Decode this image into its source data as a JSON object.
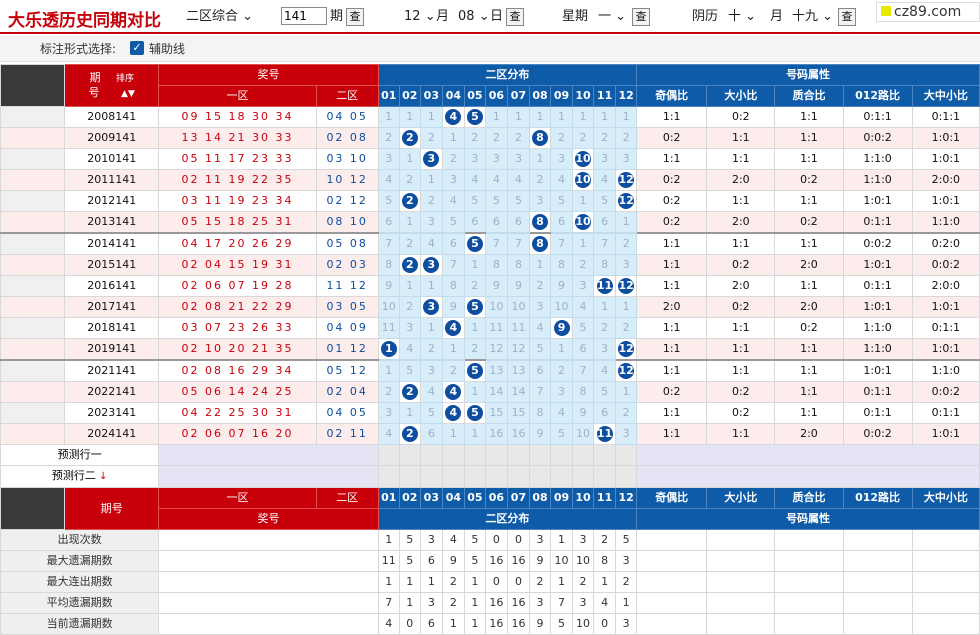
{
  "app": {
    "title": "大乐透历史同期对比",
    "logo": "cz89.com"
  },
  "toolbar": {
    "zone_select": "二区综合",
    "issue_value": "141",
    "issue_label": "期",
    "query_label": "查",
    "solar_month": "12",
    "month_label": "月",
    "solar_day": "08",
    "day_label": "日",
    "weekday_label": "星期",
    "weekday_value": "一",
    "lunar_label": "阴历",
    "lunar_month": "十",
    "lunar_day": "十九"
  },
  "filter": {
    "label": "标注形式选择:",
    "checkbox": "辅助线",
    "checked": true
  },
  "headers": {
    "issue": "期",
    "issue2": "号",
    "sort": "排序",
    "prize": "奖号",
    "zone1": "一区",
    "zone2": "二区",
    "dist": "二区分布",
    "attr": "号码属性",
    "nums": [
      "01",
      "02",
      "03",
      "04",
      "05",
      "06",
      "07",
      "08",
      "09",
      "10",
      "11",
      "12"
    ],
    "attrs": [
      "奇偶比",
      "大小比",
      "质合比",
      "012路比",
      "大中小比"
    ]
  },
  "rows": [
    {
      "issue": "2008141",
      "front": "09 15 18 30 34",
      "back": "04 05",
      "dist": [
        "1",
        "1",
        "1",
        "4",
        "5",
        "1",
        "1",
        "1",
        "1",
        "1",
        "1",
        "1"
      ],
      "balls": [
        4,
        5
      ],
      "attr": [
        "1:1",
        "0:2",
        "1:1",
        "0:1:1",
        "0:1:1"
      ]
    },
    {
      "issue": "2009141",
      "front": "13 14 21 30 33",
      "back": "02 08",
      "dist": [
        "2",
        "2",
        "2",
        "1",
        "2",
        "2",
        "2",
        "8",
        "2",
        "2",
        "2",
        "2"
      ],
      "balls": [
        2,
        8
      ],
      "attr": [
        "0:2",
        "1:1",
        "1:1",
        "0:0:2",
        "1:0:1"
      ]
    },
    {
      "issue": "2010141",
      "front": "05 11 17 23 33",
      "back": "03 10",
      "dist": [
        "3",
        "1",
        "3",
        "2",
        "3",
        "3",
        "3",
        "1",
        "3",
        "10",
        "3",
        "3"
      ],
      "balls": [
        3,
        10
      ],
      "attr": [
        "1:1",
        "1:1",
        "1:1",
        "1:1:0",
        "1:0:1"
      ]
    },
    {
      "issue": "2011141",
      "front": "02 11 19 22 35",
      "back": "10 12",
      "dist": [
        "4",
        "2",
        "1",
        "3",
        "4",
        "4",
        "4",
        "2",
        "4",
        "10",
        "4",
        "12"
      ],
      "balls": [
        10,
        12
      ],
      "attr": [
        "0:2",
        "2:0",
        "0:2",
        "1:1:0",
        "2:0:0"
      ]
    },
    {
      "issue": "2012141",
      "front": "03 11 19 23 34",
      "back": "02 12",
      "dist": [
        "5",
        "2",
        "2",
        "4",
        "5",
        "5",
        "5",
        "3",
        "5",
        "1",
        "5",
        "12"
      ],
      "balls": [
        2,
        12
      ],
      "attr": [
        "0:2",
        "1:1",
        "1:1",
        "1:0:1",
        "1:0:1"
      ]
    },
    {
      "issue": "2013141",
      "front": "05 15 18 25 31",
      "back": "08 10",
      "dist": [
        "6",
        "1",
        "3",
        "5",
        "6",
        "6",
        "6",
        "8",
        "6",
        "10",
        "6",
        "1"
      ],
      "balls": [
        8,
        10
      ],
      "attr": [
        "0:2",
        "2:0",
        "0:2",
        "0:1:1",
        "1:1:0"
      ]
    },
    {
      "issue": "2014141",
      "front": "04 17 20 26 29",
      "back": "05 08",
      "dist": [
        "7",
        "2",
        "4",
        "6",
        "5",
        "7",
        "7",
        "8",
        "7",
        "1",
        "7",
        "2"
      ],
      "balls": [
        5,
        8
      ],
      "attr": [
        "1:1",
        "1:1",
        "1:1",
        "0:0:2",
        "0:2:0"
      ]
    },
    {
      "issue": "2015141",
      "front": "02 04 15 19 31",
      "back": "02 03",
      "dist": [
        "8",
        "2",
        "3",
        "7",
        "1",
        "8",
        "8",
        "1",
        "8",
        "2",
        "8",
        "3"
      ],
      "balls": [
        2,
        3
      ],
      "attr": [
        "1:1",
        "0:2",
        "2:0",
        "1:0:1",
        "0:0:2"
      ]
    },
    {
      "issue": "2016141",
      "front": "02 06 07 19 28",
      "back": "11 12",
      "dist": [
        "9",
        "1",
        "1",
        "8",
        "2",
        "9",
        "9",
        "2",
        "9",
        "3",
        "11",
        "12"
      ],
      "balls": [
        11,
        12
      ],
      "attr": [
        "1:1",
        "2:0",
        "1:1",
        "0:1:1",
        "2:0:0"
      ]
    },
    {
      "issue": "2017141",
      "front": "02 08 21 22 29",
      "back": "03 05",
      "dist": [
        "10",
        "2",
        "3",
        "9",
        "5",
        "10",
        "10",
        "3",
        "10",
        "4",
        "1",
        "1"
      ],
      "balls": [
        3,
        5
      ],
      "attr": [
        "2:0",
        "0:2",
        "2:0",
        "1:0:1",
        "1:0:1"
      ]
    },
    {
      "issue": "2018141",
      "front": "03 07 23 26 33",
      "back": "04 09",
      "dist": [
        "11",
        "3",
        "1",
        "4",
        "1",
        "11",
        "11",
        "4",
        "9",
        "5",
        "2",
        "2"
      ],
      "balls": [
        4,
        9
      ],
      "attr": [
        "1:1",
        "1:1",
        "0:2",
        "1:1:0",
        "0:1:1"
      ]
    },
    {
      "issue": "2019141",
      "front": "02 10 20 21 35",
      "back": "01 12",
      "dist": [
        "1",
        "4",
        "2",
        "1",
        "2",
        "12",
        "12",
        "5",
        "1",
        "6",
        "3",
        "12"
      ],
      "balls": [
        1,
        12
      ],
      "attr": [
        "1:1",
        "1:1",
        "1:1",
        "1:1:0",
        "1:0:1"
      ]
    },
    {
      "issue": "2021141",
      "front": "02 08 16 29 34",
      "back": "05 12",
      "dist": [
        "1",
        "5",
        "3",
        "2",
        "5",
        "13",
        "13",
        "6",
        "2",
        "7",
        "4",
        "12"
      ],
      "balls": [
        5,
        12
      ],
      "attr": [
        "1:1",
        "1:1",
        "1:1",
        "1:0:1",
        "1:1:0"
      ]
    },
    {
      "issue": "2022141",
      "front": "05 06 14 24 25",
      "back": "02 04",
      "dist": [
        "2",
        "2",
        "4",
        "4",
        "1",
        "14",
        "14",
        "7",
        "3",
        "8",
        "5",
        "1"
      ],
      "balls": [
        2,
        4
      ],
      "attr": [
        "0:2",
        "0:2",
        "1:1",
        "0:1:1",
        "0:0:2"
      ]
    },
    {
      "issue": "2023141",
      "front": "04 22 25 30 31",
      "back": "04 05",
      "dist": [
        "3",
        "1",
        "5",
        "4",
        "5",
        "15",
        "15",
        "8",
        "4",
        "9",
        "6",
        "2"
      ],
      "balls": [
        4,
        5
      ],
      "attr": [
        "1:1",
        "0:2",
        "1:1",
        "0:1:1",
        "0:1:1"
      ]
    },
    {
      "issue": "2024141",
      "front": "02 06 07 16 20",
      "back": "02 11",
      "dist": [
        "4",
        "2",
        "6",
        "1",
        "1",
        "16",
        "16",
        "9",
        "5",
        "10",
        "11",
        "3"
      ],
      "balls": [
        2,
        11
      ],
      "attr": [
        "1:1",
        "1:1",
        "2:0",
        "0:0:2",
        "1:0:1"
      ]
    }
  ],
  "predict": {
    "row1": "预测行一",
    "row2": "预测行二"
  },
  "footer": {
    "issue": "期号",
    "zone1": "一区",
    "zone2": "二区",
    "prize": "奖号",
    "dist": "二区分布",
    "attr": "号码属性"
  },
  "stats": [
    {
      "label": "出现次数",
      "values": [
        "1",
        "5",
        "3",
        "4",
        "5",
        "0",
        "0",
        "3",
        "1",
        "3",
        "2",
        "5"
      ]
    },
    {
      "label": "最大遗漏期数",
      "values": [
        "11",
        "5",
        "6",
        "9",
        "5",
        "16",
        "16",
        "9",
        "10",
        "10",
        "8",
        "3"
      ]
    },
    {
      "label": "最大连出期数",
      "values": [
        "1",
        "1",
        "1",
        "2",
        "1",
        "0",
        "0",
        "2",
        "1",
        "2",
        "1",
        "2"
      ]
    },
    {
      "label": "平均遗漏期数",
      "values": [
        "7",
        "1",
        "3",
        "2",
        "1",
        "16",
        "16",
        "3",
        "7",
        "3",
        "4",
        "1"
      ]
    },
    {
      "label": "当前遗漏期数",
      "values": [
        "4",
        "0",
        "6",
        "1",
        "1",
        "16",
        "16",
        "9",
        "5",
        "10",
        "0",
        "3"
      ]
    }
  ],
  "colors": {
    "brand_red": "#c8000a",
    "header_blue": "#0e5ba8",
    "ball_blue": "#0e4ea0",
    "zone_bg": "#d8edfa"
  }
}
